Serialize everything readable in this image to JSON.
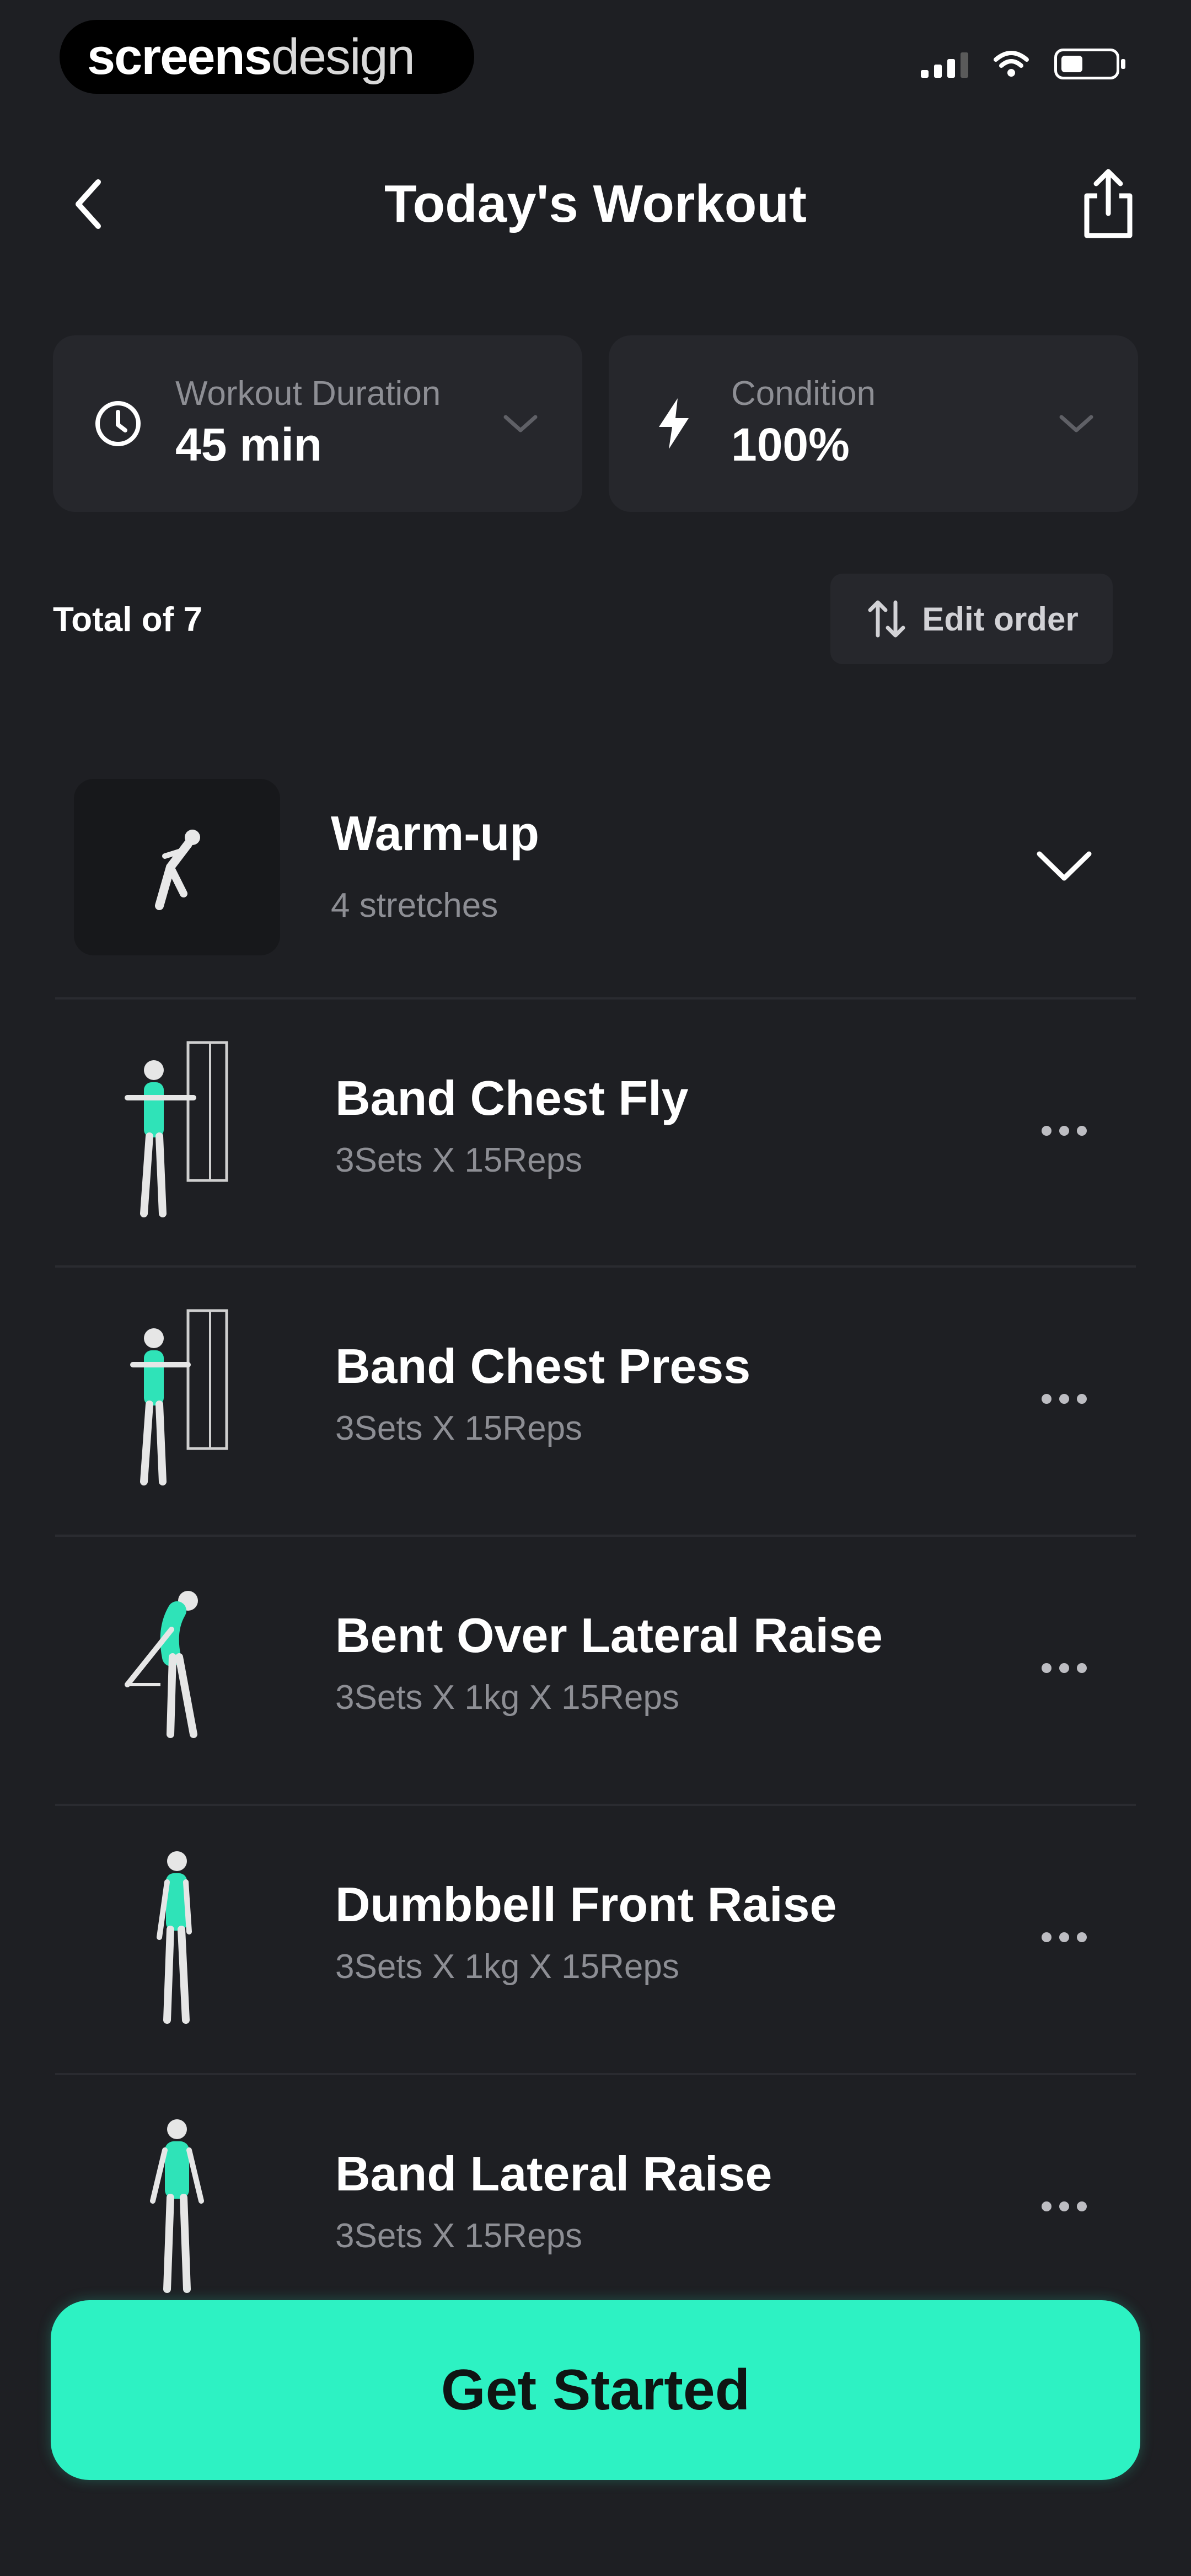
{
  "status_bar": {
    "brand_primary": "screens",
    "brand_secondary": "design"
  },
  "header": {
    "title": "Today's Workout"
  },
  "stats": {
    "duration": {
      "label": "Workout Duration",
      "value": "45 min"
    },
    "condition": {
      "label": "Condition",
      "value": "100%"
    }
  },
  "list_meta": {
    "total_text": "Total of 7",
    "edit_order_label": "Edit order"
  },
  "warmup": {
    "title": "Warm-up",
    "subtitle": "4 stretches"
  },
  "exercises": [
    {
      "name": "Band Chest Fly",
      "detail": "3Sets X 15Reps"
    },
    {
      "name": "Band Chest Press",
      "detail": "3Sets X 15Reps"
    },
    {
      "name": "Bent Over Lateral Raise",
      "detail": "3Sets X 1kg X 15Reps"
    },
    {
      "name": "Dumbbell Front Raise",
      "detail": "3Sets X 1kg X 15Reps"
    },
    {
      "name": "Band Lateral Raise",
      "detail": "3Sets X 15Reps"
    }
  ],
  "cta": {
    "label": "Get Started"
  },
  "colors": {
    "background": "#1e1f23",
    "card": "#26272c",
    "accent": "#2df2c3",
    "muted_text": "#8d8e94"
  },
  "icons": {
    "back": "chevron-left-icon",
    "share": "share-icon",
    "duration": "clock-icon",
    "condition": "lightning-icon",
    "dropdown": "chevron-down-icon",
    "edit_order": "sort-arrows-icon",
    "more": "more-horizontal-icon"
  }
}
